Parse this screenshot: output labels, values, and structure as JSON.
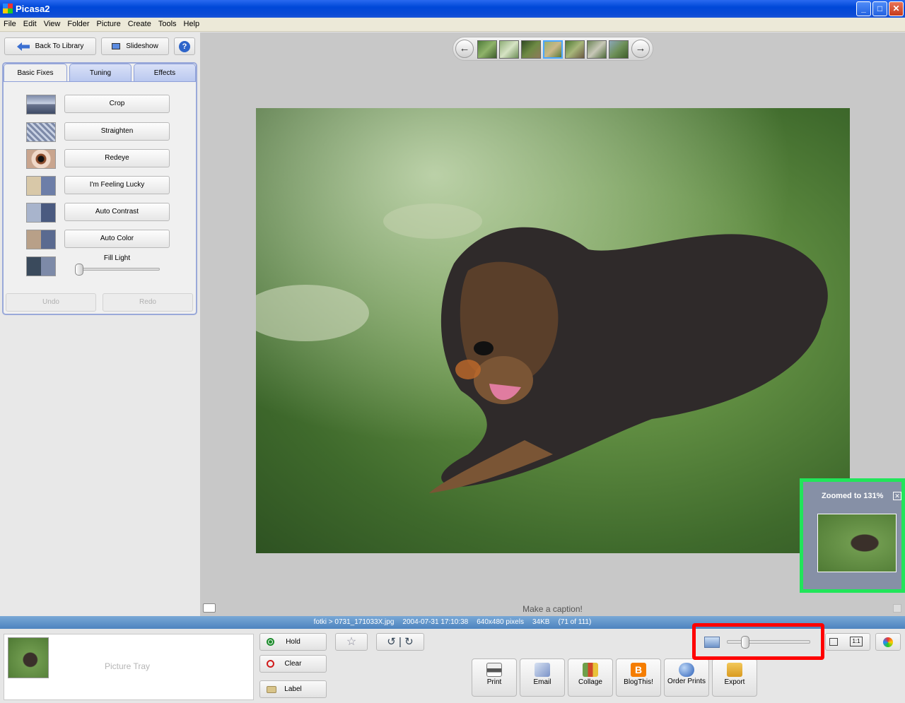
{
  "window": {
    "title": "Picasa2",
    "minimize": "_",
    "maximize": "□",
    "close": "✕"
  },
  "menu": [
    "File",
    "Edit",
    "View",
    "Folder",
    "Picture",
    "Create",
    "Tools",
    "Help"
  ],
  "toolbar": {
    "back": "Back To Library",
    "slideshow": "Slideshow",
    "help": "?"
  },
  "tabs": {
    "basic": "Basic Fixes",
    "tuning": "Tuning",
    "effects": "Effects"
  },
  "fixes": {
    "crop": "Crop",
    "straighten": "Straighten",
    "redeye": "Redeye",
    "lucky": "I'm Feeling Lucky",
    "contrast": "Auto Contrast",
    "color": "Auto Color",
    "filllight": "Fill Light",
    "undo": "Undo",
    "redo": "Redo"
  },
  "filllight_level": 0.0,
  "caption": "Make a caption!",
  "zoom": {
    "label": "Zoomed to 131%",
    "close": "✕"
  },
  "status": {
    "path": "fotki > 0731_171033X.jpg",
    "date": "2004-07-31 17:10:38",
    "dims": "640x480 pixels",
    "size": "34KB",
    "index": "(71 of 111)"
  },
  "tray": {
    "label": "Picture Tray",
    "hold": "Hold",
    "clear": "Clear",
    "label_btn": "Label"
  },
  "actions": {
    "print": "Print",
    "email": "Email",
    "collage": "Collage",
    "blog": "BlogThis!",
    "order": "Order Prints",
    "export": "Export"
  },
  "view_buttons": {
    "fit": "",
    "actual": "1:1"
  },
  "colors": {
    "highlight_green": "#21e55a",
    "highlight_red": "#ff0000",
    "status_blue": "#4d84bf"
  }
}
